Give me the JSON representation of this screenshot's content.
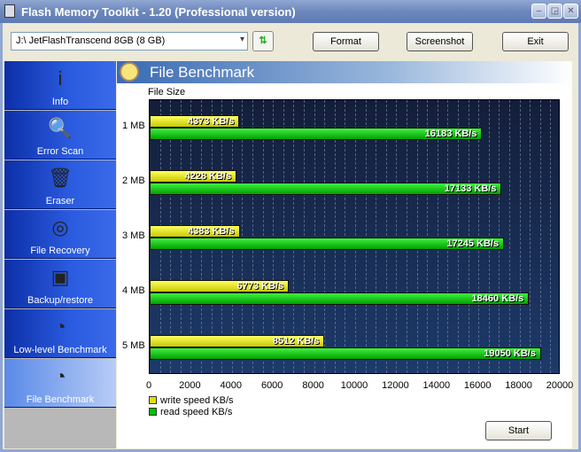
{
  "window": {
    "title": "Flash Memory Toolkit - 1.20 (Professional version)"
  },
  "toolbar": {
    "drive": "J:\\ JetFlashTranscend 8GB (8 GB)",
    "format": "Format",
    "screenshot": "Screenshot",
    "exit": "Exit"
  },
  "sidebar": {
    "items": [
      {
        "label": "Info",
        "icon": "i"
      },
      {
        "label": "Error Scan",
        "icon": "🔍"
      },
      {
        "label": "Eraser",
        "icon": "🗑"
      },
      {
        "label": "File Recovery",
        "icon": "◎"
      },
      {
        "label": "Backup/restore",
        "icon": "▣"
      },
      {
        "label": "Low-level Benchmark",
        "icon": "◔"
      },
      {
        "label": "File Benchmark",
        "icon": "◔"
      }
    ],
    "active": 6
  },
  "content": {
    "title": "File Benchmark",
    "start": "Start"
  },
  "chart_data": {
    "type": "bar",
    "orientation": "horizontal",
    "ylabel": "File Size",
    "categories": [
      "1 MB",
      "2 MB",
      "3 MB",
      "4 MB",
      "5 MB"
    ],
    "series": [
      {
        "name": "write speed KB/s",
        "color": "#e0e000",
        "values": [
          4373,
          4228,
          4383,
          6773,
          8512
        ]
      },
      {
        "name": "read speed KB/s",
        "color": "#00c000",
        "values": [
          16183,
          17133,
          17245,
          18460,
          19050
        ]
      }
    ],
    "value_suffix": " KB/s",
    "xlim": [
      0,
      20000
    ],
    "xticks": [
      "0",
      "2000",
      "4000",
      "6000",
      "8000",
      "10000",
      "12000",
      "14000",
      "16000",
      "18000",
      "20000"
    ],
    "legend": "bottom-left"
  }
}
